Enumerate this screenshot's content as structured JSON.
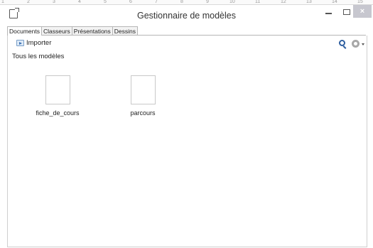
{
  "ruler": {
    "ticks": [
      "1",
      "2",
      "3",
      "4",
      "5",
      "6",
      "7",
      "8",
      "9",
      "10",
      "11",
      "12",
      "13",
      "14",
      "15"
    ]
  },
  "window": {
    "title": "Gestionnaire de modèles",
    "close_symbol": "×"
  },
  "tabs": [
    {
      "label": "Documents",
      "active": true
    },
    {
      "label": "Classeurs",
      "active": false
    },
    {
      "label": "Présentations",
      "active": false
    },
    {
      "label": "Dessins",
      "active": false
    }
  ],
  "toolbar": {
    "import_label": "Importer",
    "import_icon": "import-icon",
    "search_icon": "search-icon",
    "settings_icon": "gear-icon"
  },
  "section": {
    "label": "Tous les modèles"
  },
  "templates": [
    {
      "name": "fiche_de_cours"
    },
    {
      "name": "parcours"
    }
  ],
  "colors": {
    "accent": "#2f5fa0",
    "close_button": "#c7c7cf"
  }
}
